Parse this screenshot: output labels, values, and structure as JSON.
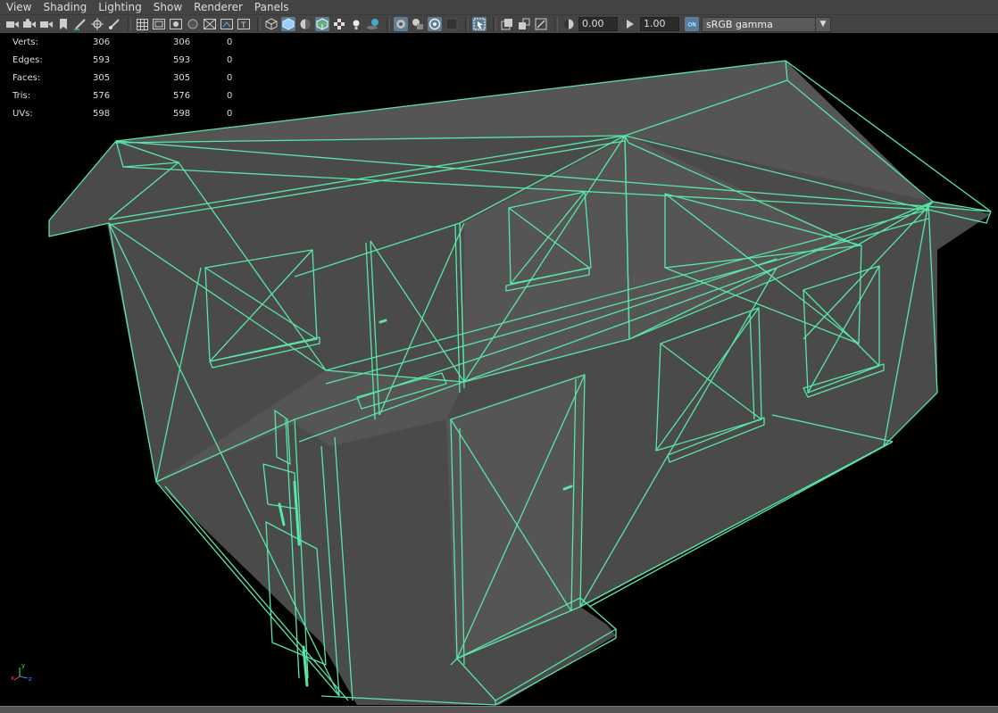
{
  "menu": {
    "items": [
      "View",
      "Shading",
      "Lighting",
      "Show",
      "Renderer",
      "Panels"
    ]
  },
  "toolbar": {
    "exposure_value": "0.00",
    "gamma_value": "1.00",
    "color_space": "sRGB gamma",
    "accent_color": "#5e7d94"
  },
  "hud": {
    "rows": [
      {
        "label": "Verts:",
        "col1": "306",
        "col2": "306",
        "col3": "0"
      },
      {
        "label": "Edges:",
        "col1": "593",
        "col2": "593",
        "col3": "0"
      },
      {
        "label": "Faces:",
        "col1": "305",
        "col2": "305",
        "col3": "0"
      },
      {
        "label": "Tris:",
        "col1": "576",
        "col2": "576",
        "col3": "0"
      },
      {
        "label": "UVs:",
        "col1": "598",
        "col2": "598",
        "col3": "0"
      }
    ]
  },
  "scene": {
    "wireframe_color": "#59e6a8",
    "face_color": "#4a4a4a",
    "background_color": "#000000"
  },
  "axis": {
    "y_label": "y",
    "x_label": "x",
    "z_label": "z"
  }
}
